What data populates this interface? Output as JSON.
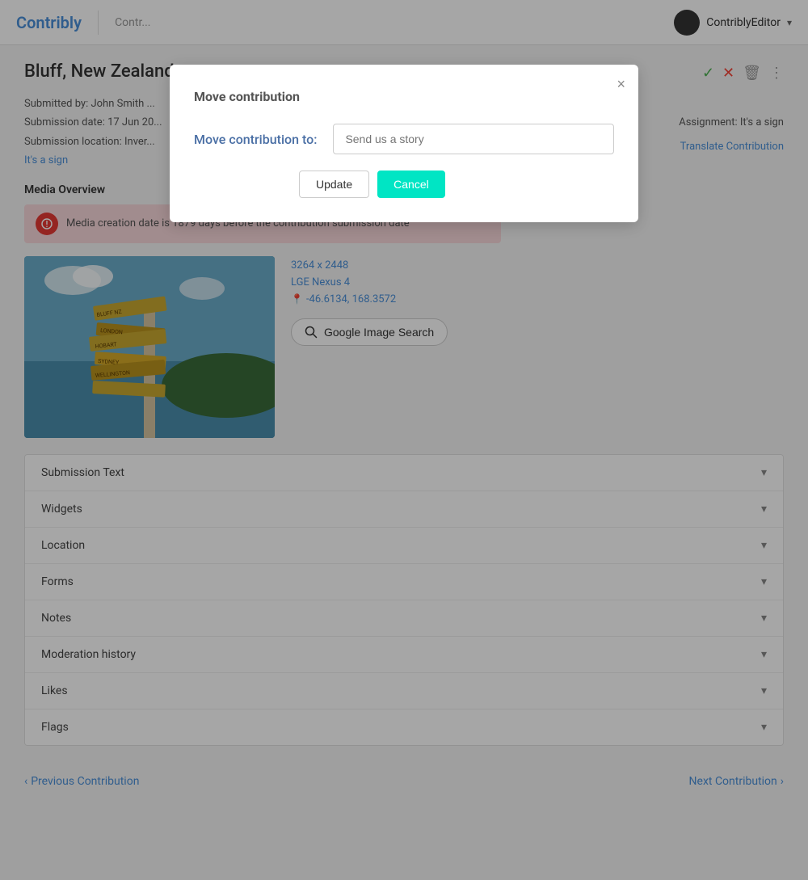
{
  "app": {
    "logo": "Contribly",
    "breadcrumb": "Contr...",
    "user": {
      "name": "ContriblyEditor",
      "avatar_bg": "#333"
    }
  },
  "page": {
    "title": "Bluff, New Zealand...",
    "assignment": "Assignment: It's a sign",
    "translate_link": "Translate Contribution",
    "meta": {
      "submitted_by": "Submitted by: John Smith ...",
      "submission_date": "Submission date: 17 Jun 20...",
      "submission_location": "Submission location: Inver...",
      "its_a_sign": "It's a sign"
    }
  },
  "media": {
    "overview_label": "Media Overview",
    "alert_text": "Media creation date is 1879 days before the contribution submission date",
    "dimension": "3264 x 2448",
    "device": "LGE Nexus 4",
    "location": "-46.6134, 168.3572",
    "google_search_label": "Google Image Search"
  },
  "accordion": {
    "items": [
      {
        "label": "Submission Text"
      },
      {
        "label": "Widgets"
      },
      {
        "label": "Location"
      },
      {
        "label": "Forms"
      },
      {
        "label": "Notes"
      },
      {
        "label": "Moderation history"
      },
      {
        "label": "Likes"
      },
      {
        "label": "Flags"
      }
    ]
  },
  "navigation": {
    "previous": "Previous Contribution",
    "next": "Next Contribution"
  },
  "modal": {
    "title": "Move contribution",
    "label": "Move contribution to:",
    "input_placeholder": "Send us a story",
    "update_btn": "Update",
    "cancel_btn": "Cancel",
    "close_btn": "×"
  }
}
